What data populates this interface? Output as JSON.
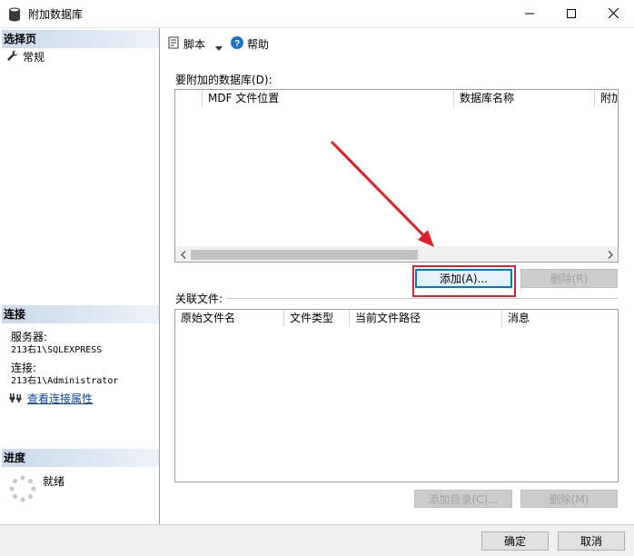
{
  "window": {
    "title": "附加数据库",
    "controls": [
      "minimize-icon",
      "maximize-icon",
      "close-icon"
    ]
  },
  "left_panel": {
    "select_page_header": "选择页",
    "pages": [
      {
        "label": "常规",
        "icon": "wrench-icon"
      }
    ],
    "connection": {
      "header": "连接",
      "server_label": "服务器:",
      "server_value": "213右1\\SQLEXPRESS",
      "connection_label": "连接:",
      "connection_value": "213右1\\Administrator",
      "view_properties_link": "查看连接属性"
    },
    "progress": {
      "header": "进度",
      "status": "就绪"
    }
  },
  "toolbar": {
    "script_label": "脚本",
    "help_label": "帮助"
  },
  "databases_to_attach": {
    "label": "要附加的数据库(D):",
    "columns": [
      "",
      "MDF 文件位置",
      "数据库名称",
      "附加"
    ],
    "rows": [],
    "add_button": "添加(A)...",
    "remove_button": "删除(R)"
  },
  "related_files": {
    "label": "关联文件:",
    "columns": [
      "原始文件名",
      "文件类型",
      "当前文件路径",
      "消息"
    ],
    "rows": [],
    "add_catalog_button": "添加目录(C)...",
    "remove_button": "删除(M)"
  },
  "footer": {
    "ok_button": "确定",
    "cancel_button": "取消"
  },
  "colors": {
    "highlight_box": "#e0202a",
    "arrow": "#e0202a",
    "section_header": "#c9d9ea",
    "link": "#0645ad"
  }
}
